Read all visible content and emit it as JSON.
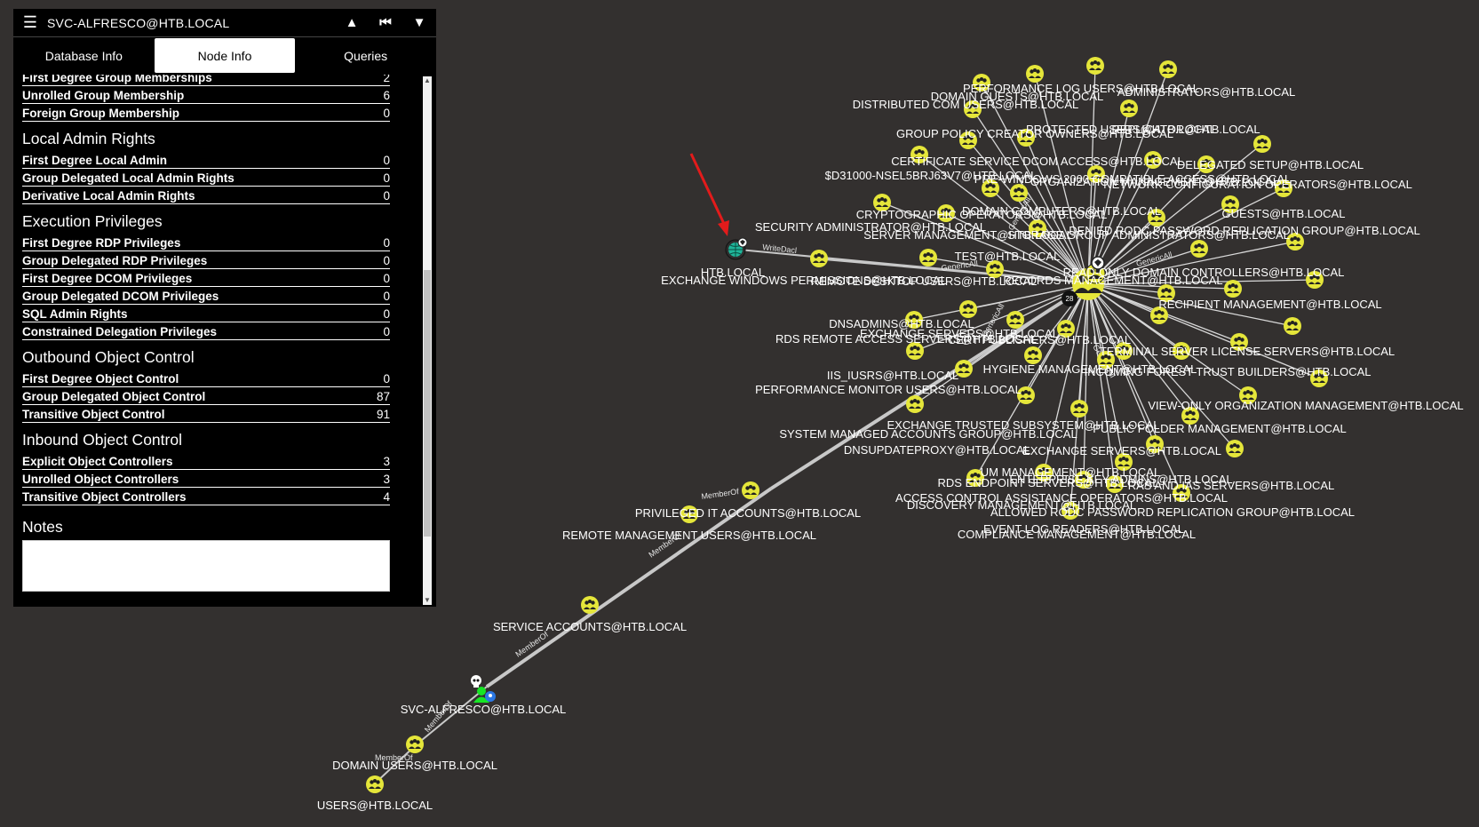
{
  "panel": {
    "title": "SVC-ALFRESCO@HTB.LOCAL",
    "header_icons": [
      "menu-icon",
      "road-icon",
      "skip-back-icon",
      "filter-icon"
    ],
    "tabs": [
      {
        "label": "Database Info",
        "active": false
      },
      {
        "label": "Node Info",
        "active": true
      },
      {
        "label": "Queries",
        "active": false
      }
    ],
    "group_membership_rows": [
      {
        "label": "First Degree Group Memberships",
        "value": "2"
      },
      {
        "label": "Unrolled Group Membership",
        "value": "6"
      },
      {
        "label": "Foreign Group Membership",
        "value": "0"
      }
    ],
    "sections": [
      {
        "title": "Local Admin Rights",
        "rows": [
          {
            "label": "First Degree Local Admin",
            "value": "0"
          },
          {
            "label": "Group Delegated Local Admin Rights",
            "value": "0"
          },
          {
            "label": "Derivative Local Admin Rights",
            "value": "0"
          }
        ]
      },
      {
        "title": "Execution Privileges",
        "rows": [
          {
            "label": "First Degree RDP Privileges",
            "value": "0"
          },
          {
            "label": "Group Delegated RDP Privileges",
            "value": "0"
          },
          {
            "label": "First Degree DCOM Privileges",
            "value": "0"
          },
          {
            "label": "Group Delegated DCOM Privileges",
            "value": "0"
          },
          {
            "label": "SQL Admin Rights",
            "value": "0"
          },
          {
            "label": "Constrained Delegation Privileges",
            "value": "0"
          }
        ]
      },
      {
        "title": "Outbound Object Control",
        "rows": [
          {
            "label": "First Degree Object Control",
            "value": "0"
          },
          {
            "label": "Group Delegated Object Control",
            "value": "87"
          },
          {
            "label": "Transitive Object Control",
            "value": "91"
          }
        ]
      },
      {
        "title": "Inbound Object Control",
        "rows": [
          {
            "label": "Explicit Object Controllers",
            "value": "3"
          },
          {
            "label": "Unrolled Object Controllers",
            "value": "3"
          },
          {
            "label": "Transitive Object Controllers",
            "value": "4"
          }
        ]
      }
    ],
    "notes_title": "Notes",
    "notes_value": ""
  },
  "graph": {
    "colors": {
      "background": "#33302f",
      "group": "#e5e63a",
      "domain": "#1fb59a",
      "user": "#17e625",
      "edge": "#c8c8c8",
      "arrow": "#e31b1b"
    },
    "hub_badge": "28",
    "edge_labels": {
      "writedacl": "WriteDacl",
      "memberof": "MemberOf",
      "genericall": "GenericAll"
    },
    "chain_nodes": [
      {
        "id": "n-svc",
        "label": "SVC-ALFRESCO@HTB.LOCAL",
        "type": "user"
      },
      {
        "id": "n-service",
        "label": "SERVICE ACCOUNTS@HTB.LOCAL",
        "type": "group"
      },
      {
        "id": "n-priv",
        "label": "PRIVILEGED IT ACCOUNTS@HTB.LOCAL",
        "type": "group"
      },
      {
        "id": "n-remote",
        "label": "REMOTE MANAGEMENT USERS@HTB.LOCAL",
        "type": "group"
      },
      {
        "id": "n-domusers",
        "label": "DOMAIN USERS@HTB.LOCAL",
        "type": "group"
      },
      {
        "id": "n-users",
        "label": "USERS@HTB.LOCAL",
        "type": "group"
      },
      {
        "id": "n-htb",
        "label": "HTB.LOCAL",
        "type": "domain"
      },
      {
        "id": "n-exch",
        "label": "EXCHANGE WINDOWS PERMISSIONS@HTB.LOCAL",
        "type": "group"
      }
    ],
    "cluster_labels": [
      "PERFORMANCE LOG USERS@HTB.LOCAL",
      "DOMAIN GUESTS@HTB.LOCAL",
      "ADMINISTRATORS@HTB.LOCAL",
      "DISTRIBUTED COM USERS@HTB.LOCAL",
      "PROTECTED USERS@HTB.LOCAL",
      "REPLICATOR@HTB.LOCAL",
      "GROUP POLICY CREATOR OWNERS@HTB.LOCAL",
      "CERTIFICATE SERVICE DCOM ACCESS@HTB.LOCAL",
      "DELEGATED SETUP@HTB.LOCAL",
      "$D31000-NSEL5BRJ63V7@HTB.LOCAL",
      "PRE-WINDOWS 2000 COMPATIBLE ACCESS@HTB.LOCAL",
      "ORGANIZATION MANAGEMENT@HTB.LOCAL",
      "NETWORK CONFIGURATION OPERATORS@HTB.LOCAL",
      "DOMAIN COMPUTERS@HTB.LOCAL",
      "CRYPTOGRAPHIC OPERATORS@HTB.LOCAL",
      "GUESTS@HTB.LOCAL",
      "SECURITY ADMINISTRATOR@HTB.LOCAL",
      "DENIED RODC PASSWORD REPLICATION GROUP@HTB.LOCAL",
      "SERVER MANAGEMENT@HTB.LOCAL",
      "STORAGE GROUP ADMINISTRATORS@HTB.LOCAL",
      "TEST@HTB.LOCAL",
      "REMOTE DESKTOP USERS@HTB.LOCAL",
      "READ-ONLY DOMAIN CONTROLLERS@HTB.LOCAL",
      "RECORDS MANAGEMENT@HTB.LOCAL",
      "DNSADMINS@HTB.LOCAL",
      "RECIPIENT MANAGEMENT@HTB.LOCAL",
      "RDS REMOTE ACCESS SERVERS@HTB.LOCAL",
      "EXCHANGE SERVERS@HTB.LOCAL",
      "CERT PUBLISHERS@HTB.LOCAL",
      "TERMINAL SERVER LICENSE SERVERS@HTB.LOCAL",
      "IIS_IUSRS@HTB.LOCAL",
      "HYGIENE MANAGEMENT@HTB.LOCAL",
      "INCOMING FOREST TRUST BUILDERS@HTB.LOCAL",
      "PERFORMANCE MONITOR USERS@HTB.LOCAL",
      "VIEW-ONLY ORGANIZATION MANAGEMENT@HTB.LOCAL",
      "SYSTEM MANAGED ACCOUNTS GROUP@HTB.LOCAL",
      "EXCHANGE TRUSTED SUBSYSTEM@HTB.LOCAL",
      "PUBLIC FOLDER MANAGEMENT@HTB.LOCAL",
      "DNSUPDATEPROXY@HTB.LOCAL",
      "EXCHANGE SERVERS@HTB.LOCAL",
      "UM MANAGEMENT@HTB.LOCAL",
      "RDS ENDPOINT SERVERS@HTB.LOCAL",
      "RAS AND IAS SERVERS@HTB.LOCAL",
      "ACCESS CONTROL ASSISTANCE OPERATORS@HTB.LOCAL",
      "ALLOWED RODC PASSWORD REPLICATION GROUP@HTB.LOCAL",
      "EVENT LOG READERS@HTB.LOCAL",
      "DISCOVERY MANAGEMENT@HTB.LOCAL",
      "ENTERPRISE KEY ADMINS@HTB.LOCAL",
      "COMPLIANCE MANAGEMENT@HTB.LOCAL"
    ]
  }
}
